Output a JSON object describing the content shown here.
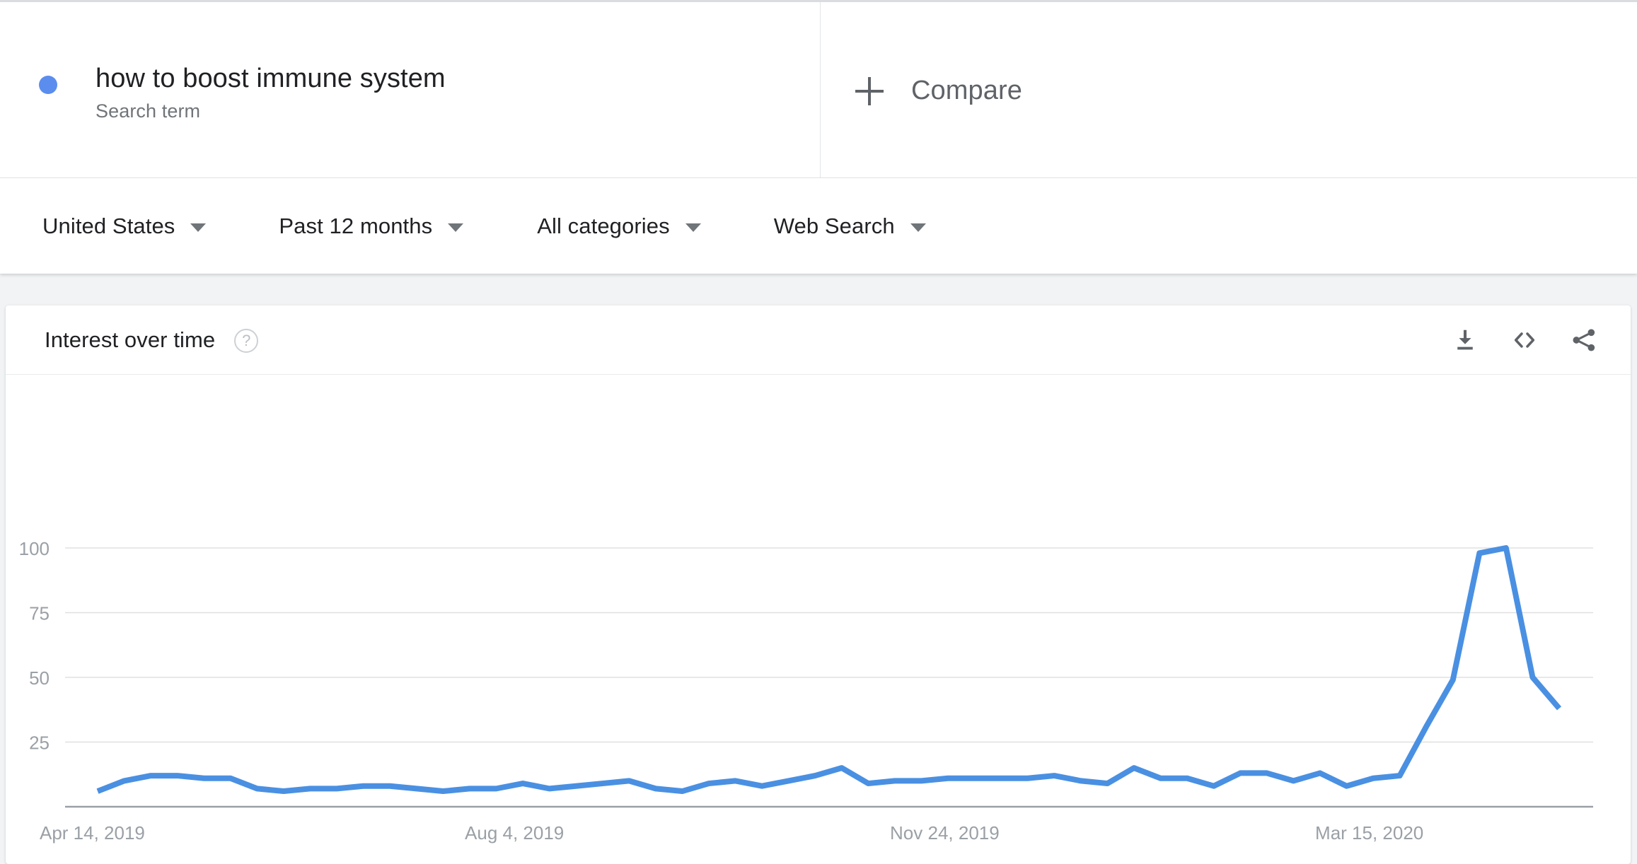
{
  "search_term": {
    "title": "how to boost immune system",
    "subtitle": "Search term",
    "dot_color": "#5b8def"
  },
  "compare": {
    "label": "Compare",
    "plus_icon": "plus-icon"
  },
  "filters": [
    {
      "label": "United States",
      "icon": "chevron-down-icon"
    },
    {
      "label": "Past 12 months",
      "icon": "chevron-down-icon"
    },
    {
      "label": "All categories",
      "icon": "chevron-down-icon"
    },
    {
      "label": "Web Search",
      "icon": "chevron-down-icon"
    }
  ],
  "interest_card": {
    "title": "Interest over time",
    "help_icon": "help-circle-icon",
    "help_glyph": "?",
    "actions": [
      {
        "name": "download-icon",
        "label": "Download"
      },
      {
        "name": "embed-code-icon",
        "label": "Embed"
      },
      {
        "name": "share-icon",
        "label": "Share"
      }
    ]
  },
  "chart_data": {
    "type": "line",
    "title": "Interest over time",
    "xlabel": "",
    "ylabel": "",
    "ylim": [
      0,
      100
    ],
    "yticks": [
      25,
      50,
      75,
      100
    ],
    "ytick_labels": [
      "25",
      "50",
      "75",
      "100"
    ],
    "grid": true,
    "legend_position": "none",
    "line_color": "#4a90e2",
    "xtick_labels": [
      "Apr 14, 2019",
      "Aug 4, 2019",
      "Nov 24, 2019",
      "Mar 15, 2020"
    ],
    "xtick_indices": [
      0,
      16,
      32,
      48
    ],
    "series": [
      {
        "name": "how to boost immune system",
        "color": "#4a90e2",
        "values": [
          6,
          10,
          12,
          12,
          11,
          11,
          7,
          6,
          7,
          7,
          8,
          8,
          7,
          6,
          7,
          7,
          9,
          7,
          8,
          9,
          10,
          7,
          6,
          9,
          10,
          8,
          10,
          12,
          15,
          9,
          10,
          10,
          11,
          11,
          11,
          11,
          12,
          10,
          9,
          15,
          11,
          11,
          8,
          13,
          13,
          10,
          13,
          8,
          11,
          12,
          31,
          49,
          98,
          100,
          50,
          38
        ]
      }
    ]
  }
}
